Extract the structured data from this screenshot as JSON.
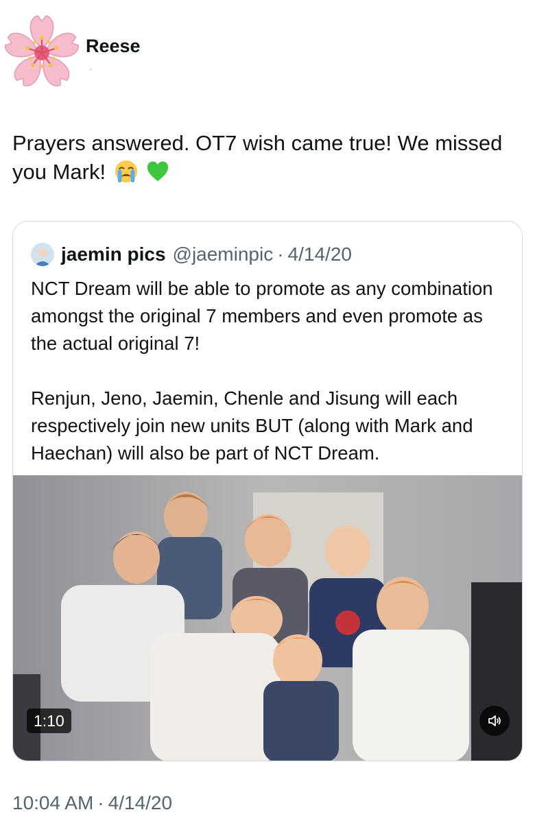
{
  "author": {
    "display_name": "Reese",
    "handle_mark": "·",
    "avatar_icon": "cherry-blossom-icon"
  },
  "tweet": {
    "text": "Prayers answered. OT7 wish came true! We missed you Mark!",
    "emojis": [
      "loudly-crying-face-icon",
      "green-heart-icon"
    ]
  },
  "quote": {
    "display_name": "jaemin pics",
    "handle": "@jaeminpic",
    "separator": "·",
    "date": "4/14/20",
    "paragraph_1": "NCT Dream will be able to promote as any combination amongst the original 7 members and even promote as the actual original 7!",
    "paragraph_2": "Renjun, Jeno, Jaemin, Chenle and Jisung will each respectively join new units BUT (along with Mark and Haechan) will also be part of NCT Dream.",
    "video": {
      "duration": "1:10",
      "mute_icon": "speaker-icon"
    }
  },
  "footer": {
    "time": "10:04 AM",
    "separator": "·",
    "date": "4/14/20"
  },
  "colors": {
    "text_primary": "#0f1419",
    "text_secondary": "#536471",
    "card_border": "#cfd9de",
    "blossom_pink": "#f4b6c8",
    "green_heart": "#2ecc40"
  }
}
